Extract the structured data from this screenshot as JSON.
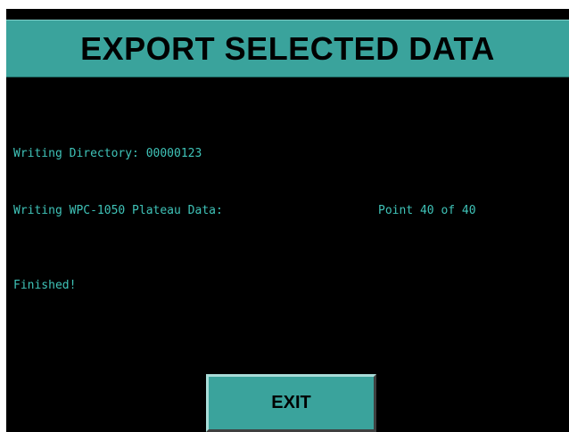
{
  "title": "EXPORT SELECTED DATA",
  "status": {
    "directory_line": "Writing Directory: 00000123",
    "data_line": "Writing WPC-1050 Plateau Data:",
    "progress": "Point 40 of 40",
    "finished": "Finished!"
  },
  "exit_button": {
    "label": "EXIT"
  },
  "colors": {
    "accent": "#3aa39c",
    "text": "#3fc3b8",
    "background": "#000000"
  }
}
